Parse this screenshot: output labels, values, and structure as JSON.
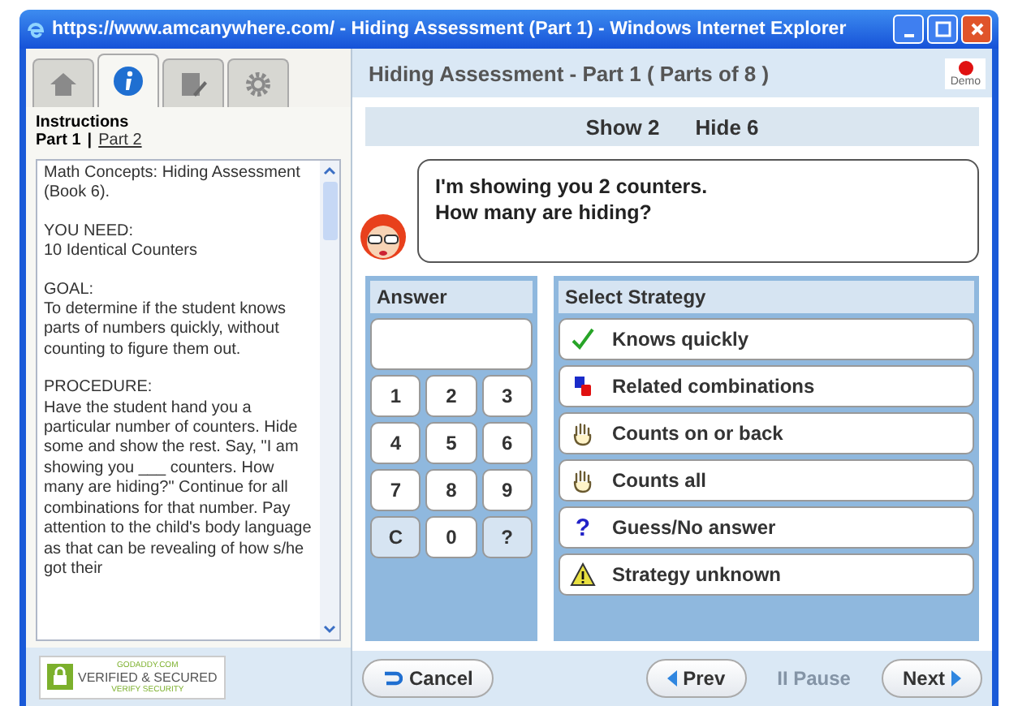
{
  "window": {
    "title": "https://www.amcanywhere.com/ - Hiding Assessment (Part 1) - Windows Internet Explorer"
  },
  "sidebar": {
    "tabs": [
      {
        "kind": "home",
        "selected": false
      },
      {
        "kind": "info",
        "selected": true
      },
      {
        "kind": "edit",
        "selected": false
      },
      {
        "kind": "gear",
        "selected": false
      }
    ],
    "heading": "Instructions",
    "parts": [
      {
        "label": "Part 1",
        "selected": true
      },
      {
        "label": "Part 2",
        "selected": false
      }
    ],
    "separator": "|",
    "instructions": [
      "Math Concepts: Hiding Assessment (Book 6).",
      "YOU NEED:\n10 Identical Counters",
      "GOAL:\nTo determine if the student knows parts of numbers quickly, without counting to figure them out.",
      "PROCEDURE:\nHave the student hand you a particular number of counters. Hide some and show the rest. Say, \"I am showing you ___ counters. How many are hiding?\" Continue for all combinations for that number. Pay attention to the child's body language as that can be revealing of how s/he got their"
    ],
    "badge": {
      "top": "GODADDY.COM",
      "main": "VERIFIED & SECURED",
      "bottom": "VERIFY SECURITY"
    }
  },
  "header": {
    "title": "Hiding Assessment - Part 1 ( Parts of 8 )",
    "demo": "Demo"
  },
  "counts": [
    "Show 2",
    "Hide 6"
  ],
  "prompt": [
    "I'm showing you 2 counters.",
    "How many are hiding?"
  ],
  "answer": {
    "title": "Answer",
    "keys": [
      {
        "label": "1",
        "kind": "digit"
      },
      {
        "label": "2",
        "kind": "digit"
      },
      {
        "label": "3",
        "kind": "digit"
      },
      {
        "label": "4",
        "kind": "digit"
      },
      {
        "label": "5",
        "kind": "digit"
      },
      {
        "label": "6",
        "kind": "digit"
      },
      {
        "label": "7",
        "kind": "digit"
      },
      {
        "label": "8",
        "kind": "digit"
      },
      {
        "label": "9",
        "kind": "digit"
      },
      {
        "label": "C",
        "kind": "special"
      },
      {
        "label": "0",
        "kind": "digit"
      },
      {
        "label": "?",
        "kind": "special"
      }
    ]
  },
  "strategy": {
    "title": "Select Strategy",
    "options": [
      {
        "label": "Knows quickly",
        "kind": "check"
      },
      {
        "label": "Related combinations",
        "kind": "blocks"
      },
      {
        "label": "Counts on or back",
        "kind": "hand"
      },
      {
        "label": "Counts all",
        "kind": "hand"
      },
      {
        "label": "Guess/No answer",
        "kind": "question",
        "icon": "?"
      },
      {
        "label": "Strategy unknown",
        "kind": "warning"
      }
    ]
  },
  "footer": {
    "cancel": "Cancel",
    "prev": "Prev",
    "pause": {
      "label": "Pause",
      "icon": "II",
      "disabled": true
    },
    "next": "Next"
  }
}
